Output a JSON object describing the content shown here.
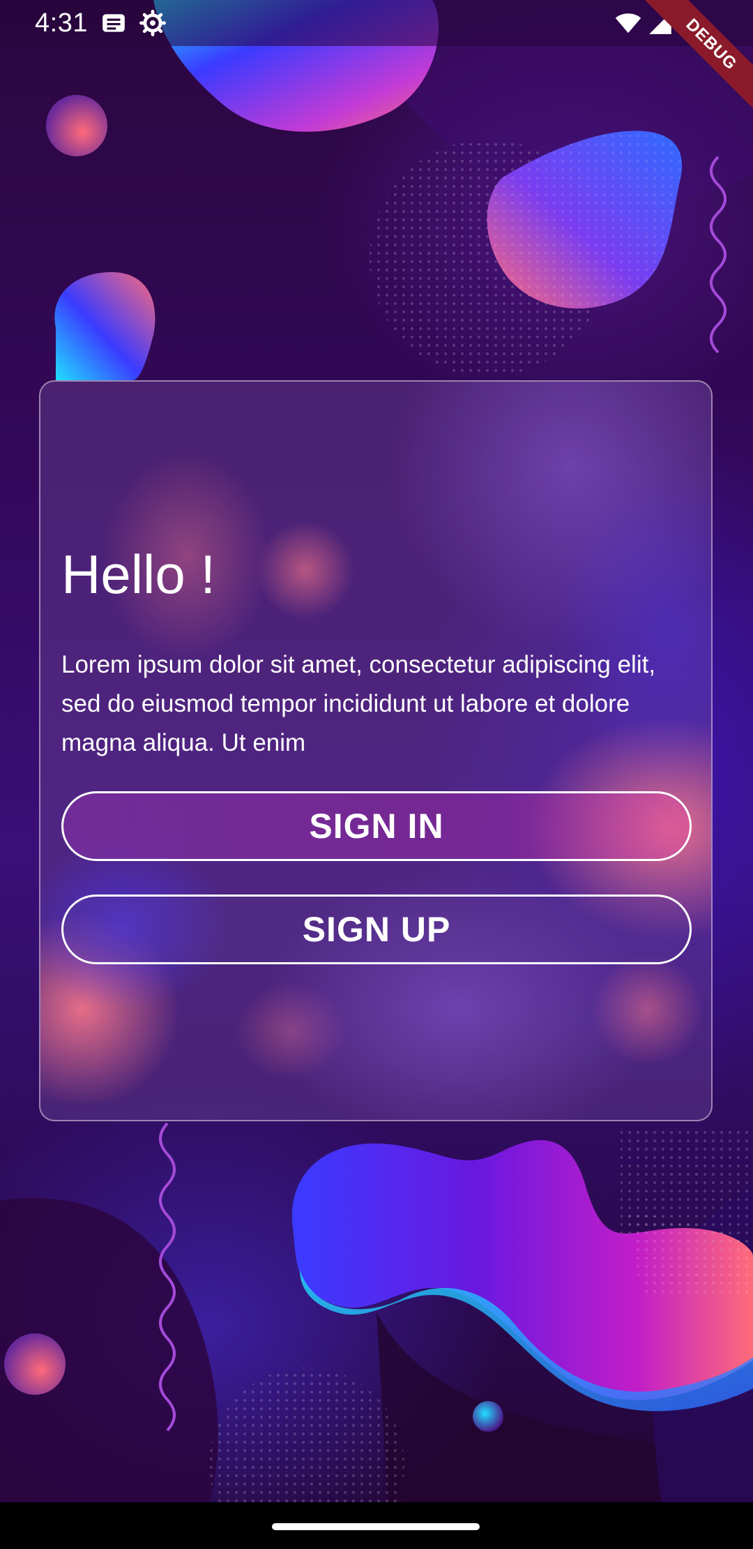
{
  "status_bar": {
    "time": "4:31",
    "icons": [
      "message-notification-icon",
      "settings-gear-icon",
      "wifi-icon",
      "cell-signal-icon"
    ],
    "debug_label": "DEBUG"
  },
  "card": {
    "title": "Hello !",
    "body": "Lorem ipsum dolor sit amet, consectetur adipiscing elit, sed do eiusmod tempor incididunt ut labore et dolore magna aliqua. Ut enim",
    "sign_in_label": "SIGN IN",
    "sign_up_label": "SIGN UP"
  },
  "colors": {
    "background_dark": "#2a0638",
    "accent_purple": "#3a0f78",
    "blob_pink": "#ff6b7a",
    "blob_blue": "#3b3bff",
    "debug_ribbon": "#8b1b2a"
  }
}
